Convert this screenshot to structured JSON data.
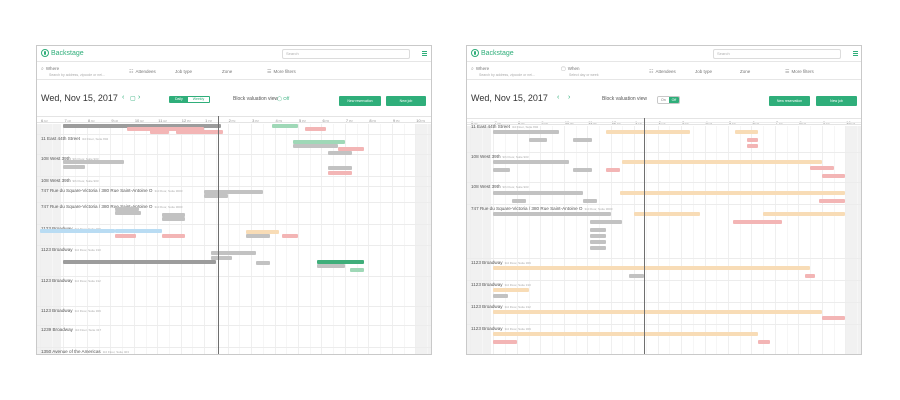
{
  "app": {
    "name": "Backstage",
    "search_placeholder": "Search"
  },
  "filters": {
    "where": {
      "label": "Where",
      "placeholder": "Search by address, zipcode or nei..."
    },
    "when": {
      "label": "When",
      "placeholder": "Select day or week"
    },
    "attendees": "Attendees",
    "job_type": "Job type",
    "zone": "Zone",
    "more": "More filters"
  },
  "date": "Wed, Nov 15, 2017",
  "view_toggle": {
    "daily": "Daily",
    "weekly": "Weekly"
  },
  "block_valuation": {
    "label": "Block valuation view",
    "value_left": "Off",
    "on": "On",
    "off": "Off"
  },
  "buttons": {
    "new_reservation": "New reservation",
    "new_job": "New job"
  },
  "hours": [
    "6",
    "7",
    "8",
    "9",
    "10",
    "11",
    "12",
    "1",
    "2",
    "3",
    "4",
    "5",
    "6",
    "7",
    "8",
    "9",
    "10"
  ],
  "hour_suffix": [
    "AM",
    "AM",
    "AM",
    "AM",
    "AM",
    "AM",
    "PM",
    "PM",
    "PM",
    "PM",
    "PM",
    "PM",
    "PM",
    "PM",
    "PM",
    "PM",
    "PM"
  ],
  "left_rows": [
    {
      "name": "11 East 44th Street",
      "sub": "3rd Floor, Suite 802"
    },
    {
      "name": "108 West 39th",
      "sub": "9th Floor, Suite 903"
    },
    {
      "name": "108 West 39th",
      "sub": "9th Floor, Suite 903"
    },
    {
      "name": "747 Rue du Square-Victoria / 380 Rue Saint-Antoine O",
      "sub": "3rd Floor, Suite 3000"
    },
    {
      "name": "747 Rue du Square-Victoria / 380 Rue Saint-Antoine O",
      "sub": "3rd Floor, Suite 3000"
    },
    {
      "name": "1123 Broadway",
      "sub": "3rd Floor, Suite 309"
    },
    {
      "name": "1123 Broadway",
      "sub": "3rd Floor, Suite 310"
    },
    {
      "name": "1123 Broadway",
      "sub": "3rd Floor, Suite 312"
    },
    {
      "name": "1123 Broadway",
      "sub": "3rd Floor, Suite 309"
    },
    {
      "name": "1239 Broadway",
      "sub": "3rd Floor, Suite 317"
    },
    {
      "name": "1350 Avenue of the Americas",
      "sub": "3rd Floor, Suite 403"
    }
  ],
  "right_rows": [
    {
      "name": "11 East 44th Street",
      "sub": "3rd Floor, Suite 802"
    },
    {
      "name": "108 West 39th",
      "sub": "9th Floor, Suite 903"
    },
    {
      "name": "108 West 39th",
      "sub": "9th Floor, Suite 903"
    },
    {
      "name": "747 Rue du Square-Victoria / 380 Rue Saint-Antoine O",
      "sub": "3rd Floor, Suite 3000"
    },
    {
      "name": "1123 Broadway",
      "sub": "3rd Floor, Suite 309"
    },
    {
      "name": "1123 Broadway",
      "sub": "3rd Floor, Suite 310"
    },
    {
      "name": "1123 Broadway",
      "sub": "3rd Floor, Suite 312"
    },
    {
      "name": "1123 Broadway",
      "sub": "3rd Floor, Suite 309"
    }
  ],
  "colors": {
    "accent": "#2fae7a",
    "booked": "#c2c2c2",
    "alert": "#f3b5b5",
    "pending": "#f8dcb6",
    "confirmed": "#9fd8b7"
  }
}
